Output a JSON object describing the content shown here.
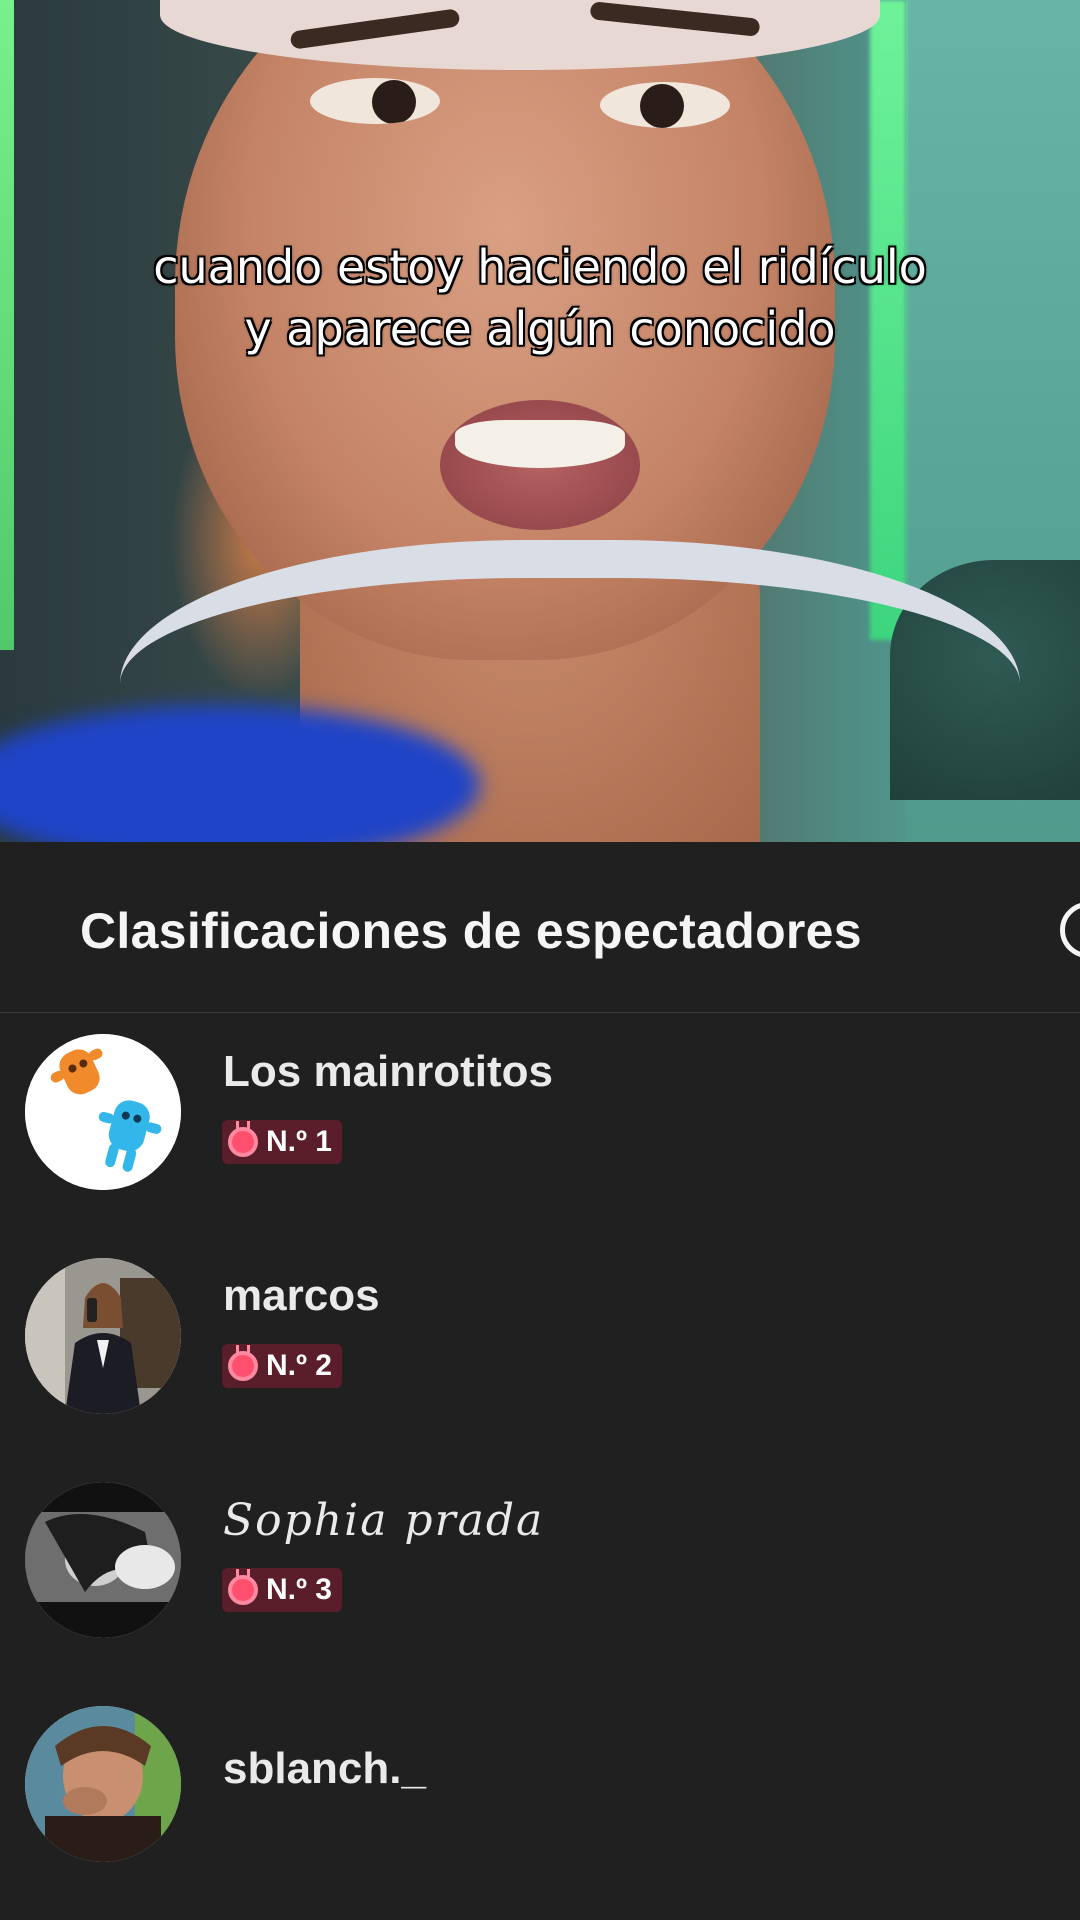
{
  "video": {
    "caption": "cuando estoy haciendo el ridículo y aparece algún conocido"
  },
  "panel": {
    "title": "Clasificaciones de espectadores",
    "info_icon": "info-icon"
  },
  "viewers": [
    {
      "name": "Los mainrotitos",
      "rank": "N.º 1",
      "avatar": "toy-figures-avatar"
    },
    {
      "name": "marcos",
      "rank": "N.º 2",
      "avatar": "woman-in-suit-avatar"
    },
    {
      "name": "Sophia prada",
      "rank": "N.º 3",
      "avatar": "black-and-white-selfie-avatar"
    },
    {
      "name": "sblanch._",
      "rank": "",
      "avatar": "selfie-avatar"
    }
  ],
  "colors": {
    "panel_bg": "#202020",
    "badge_bg": "#5a1e2a",
    "medal": "#ff4f6e",
    "text": "#eaeaea"
  }
}
